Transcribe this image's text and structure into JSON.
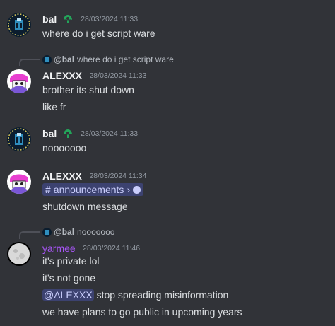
{
  "messages": [
    {
      "author": "bal",
      "has_badge": true,
      "timestamp": "28/03/2024 11:33",
      "lines": [
        "where do i get script ware"
      ]
    },
    {
      "reply": {
        "author": "@bal",
        "text": "where do i get script ware"
      },
      "author": "ALEXXX",
      "timestamp": "28/03/2024 11:33",
      "lines": [
        "brother its shut down",
        "like fr"
      ]
    },
    {
      "author": "bal",
      "has_badge": true,
      "timestamp": "28/03/2024 11:33",
      "lines": [
        "nooooooo"
      ]
    },
    {
      "author": "ALEXXX",
      "timestamp": "28/03/2024 11:34",
      "channel_link": {
        "name": "announcements",
        "chevron": "›",
        "icon": "thread-bubble-icon"
      },
      "lines": [
        "shutdown message"
      ]
    },
    {
      "reply": {
        "author": "@bal",
        "text": "nooooooo"
      },
      "author": "yarmee",
      "author_color": "#a855f7",
      "timestamp": "28/03/2024 11:46",
      "lines": [
        "it's private lol",
        "it's not gone"
      ],
      "mention_line": {
        "mention": "@ALEXXX",
        "text": " stop spreading misinformation"
      },
      "last_line": "we have plans to go public in upcoming years"
    }
  ],
  "colors": {
    "background": "#313338",
    "text": "#dbdee1",
    "muted": "#949ba4",
    "mention_bg": "#3c4270",
    "mention_fg": "#c9cdfb",
    "badge": "#23a55a",
    "yarmee": "#a855f7"
  }
}
